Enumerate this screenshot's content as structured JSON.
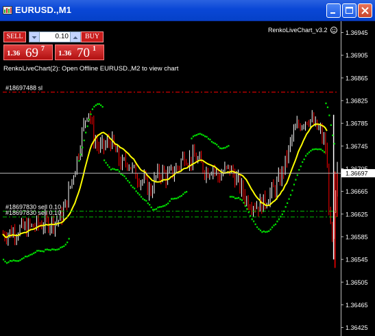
{
  "window": {
    "title": "EURUSD.,M1",
    "buttons": [
      "minimize",
      "maximize",
      "close"
    ]
  },
  "trade_panel": {
    "sell_label": "SELL",
    "buy_label": "BUY",
    "lot_value": "0.10",
    "bid": {
      "prefix": "1.36",
      "big": "69",
      "sup": "7"
    },
    "ask": {
      "prefix": "1.36",
      "big": "70",
      "sup": "1"
    }
  },
  "indicator_label": "RenkoLiveChart_v3.2",
  "indicator_icon": "smiley-icon",
  "comment": "RenkoLiveChart(2): Open Offline EURUSD.,M2 to view chart",
  "order_lines": [
    {
      "label": "#18697488 sl",
      "price": 1.3684,
      "color": "#ff0000"
    },
    {
      "label": "#18697830 sell 0.10",
      "price": 1.3663,
      "color": "#00c000"
    },
    {
      "label": "#18697830 sell 0.10",
      "price": 1.3662,
      "color": "#00c000"
    }
  ],
  "price_axis": {
    "ticks": [
      "1.36945",
      "1.36905",
      "1.36865",
      "1.36825",
      "1.36785",
      "1.36745",
      "1.36705",
      "1.36665",
      "1.36625",
      "1.36585",
      "1.36545",
      "1.36505",
      "1.36465",
      "1.36425"
    ],
    "current_price": "1.36697"
  },
  "colors": {
    "background": "#000000",
    "candle_up": "#ffffff",
    "candle_down": "#ff0000",
    "ma_fast": "#ffff00",
    "ma_trail": "#00e000",
    "sl_line": "#ff0000",
    "order_line": "#00c000",
    "bid_line": "#c0c0c0"
  },
  "chart_data": {
    "type": "candlestick",
    "symbol": "EURUSD.",
    "timeframe": "M1",
    "ylim": [
      1.3641,
      1.36965
    ],
    "close_path": [
      1.3659,
      1.36592,
      1.36595,
      1.36598,
      1.366,
      1.36602,
      1.36605,
      1.36608,
      1.3661,
      1.36612,
      1.36615,
      1.3664,
      1.3668,
      1.3672,
      1.3677,
      1.36815,
      1.3676,
      1.3674,
      1.36745,
      1.36755,
      1.3673,
      1.3671,
      1.3672,
      1.367,
      1.3669,
      1.3668,
      1.36665,
      1.3669,
      1.367,
      1.3669,
      1.367,
      1.3671,
      1.3673,
      1.3672,
      1.36725,
      1.3671,
      1.367,
      1.3671,
      1.3669,
      1.367,
      1.36705,
      1.3669,
      1.3667,
      1.3665,
      1.36645,
      1.3664,
      1.36645,
      1.3666,
      1.3667,
      1.3669,
      1.3672,
      1.3676,
      1.3678,
      1.3679,
      1.36795,
      1.3678,
      1.3677,
      1.3674,
      1.3656,
      1.36697
    ]
  }
}
